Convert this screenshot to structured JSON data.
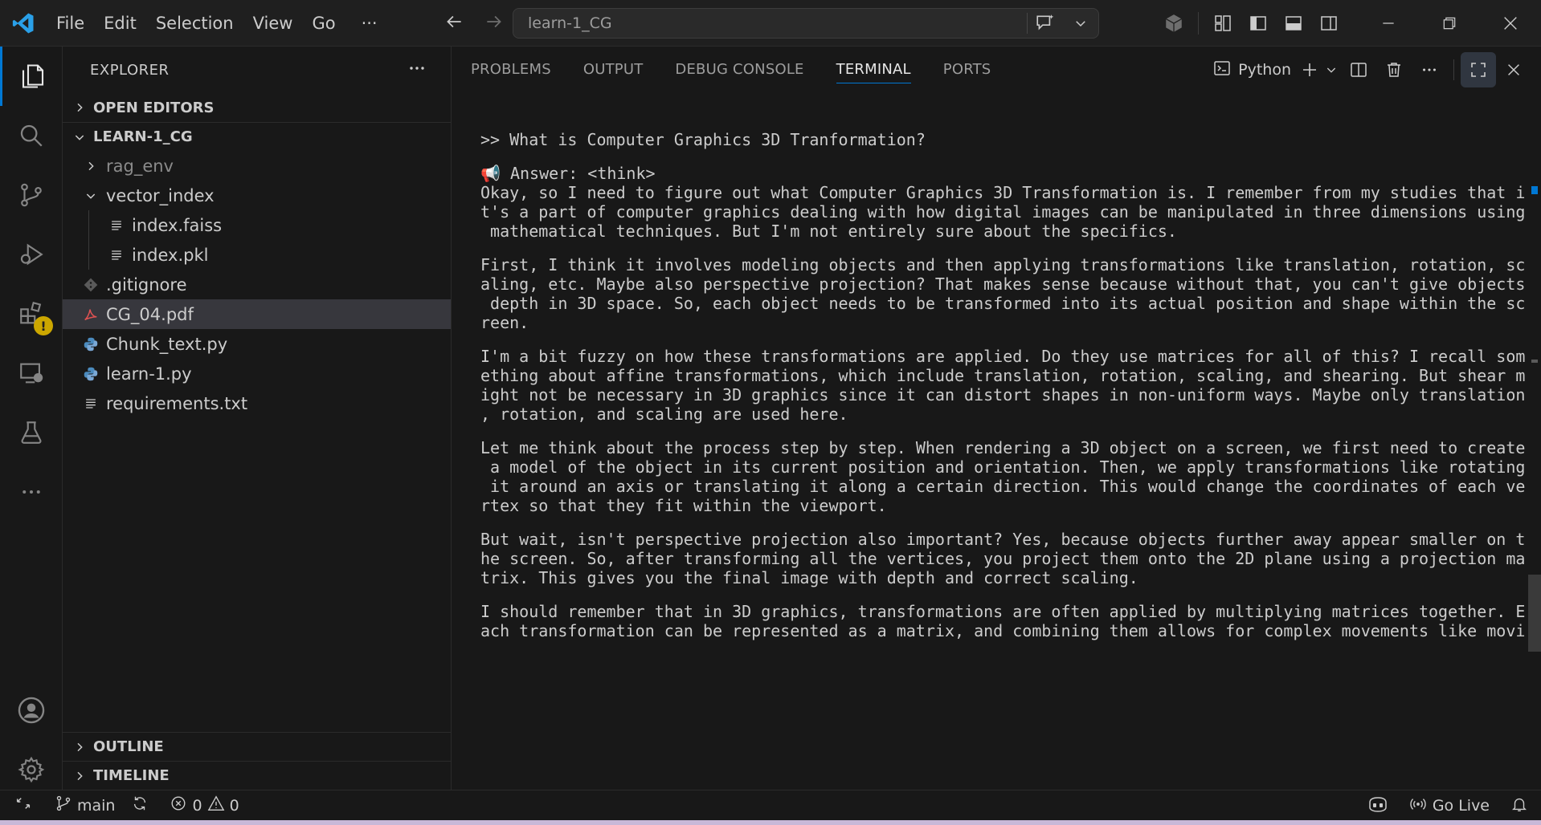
{
  "titlebar": {
    "menu": [
      "File",
      "Edit",
      "Selection",
      "View",
      "Go",
      "···"
    ],
    "search_text": "learn-1_CG"
  },
  "sidebar": {
    "title": "EXPLORER",
    "open_editors": "OPEN EDITORS",
    "project": "LEARN-1_CG",
    "tree": [
      {
        "label": "rag_env",
        "kind": "folder-collapsed",
        "dim": true
      },
      {
        "label": "vector_index",
        "kind": "folder-expanded"
      },
      {
        "label": "index.faiss",
        "kind": "file"
      },
      {
        "label": "index.pkl",
        "kind": "file"
      },
      {
        "label": ".gitignore",
        "kind": "git"
      },
      {
        "label": "CG_04.pdf",
        "kind": "pdf",
        "selected": true
      },
      {
        "label": "Chunk_text.py",
        "kind": "python"
      },
      {
        "label": "learn-1.py",
        "kind": "python"
      },
      {
        "label": "requirements.txt",
        "kind": "file"
      }
    ],
    "outline": "OUTLINE",
    "timeline": "TIMELINE"
  },
  "panel": {
    "tabs": [
      "PROBLEMS",
      "OUTPUT",
      "DEBUG CONSOLE",
      "TERMINAL",
      "PORTS"
    ],
    "active_tab": 3,
    "profile": "Python",
    "terminal_lines": [
      "",
      ">> What is Computer Graphics 3D Tranformation?",
      "",
      "📢 Answer: <think>",
      "Okay, so I need to figure out what Computer Graphics 3D Transformation is. I remember from my studies that i",
      "t's a part of computer graphics dealing with how digital images can be manipulated in three dimensions using",
      " mathematical techniques. But I'm not entirely sure about the specifics.",
      "",
      "First, I think it involves modeling objects and then applying transformations like translation, rotation, sc",
      "aling, etc. Maybe also perspective projection? That makes sense because without that, you can't give objects",
      " depth in 3D space. So, each object needs to be transformed into its actual position and shape within the sc",
      "reen.",
      "",
      "I'm a bit fuzzy on how these transformations are applied. Do they use matrices for all of this? I recall som",
      "ething about affine transformations, which include translation, rotation, scaling, and shearing. But shear m",
      "ight not be necessary in 3D graphics since it can distort shapes in non-uniform ways. Maybe only translation",
      ", rotation, and scaling are used here.",
      "",
      "Let me think about the process step by step. When rendering a 3D object on a screen, we first need to create",
      " a model of the object in its current position and orientation. Then, we apply transformations like rotating",
      " it around an axis or translating it along a certain direction. This would change the coordinates of each ve",
      "rtex so that they fit within the viewport.",
      "",
      "But wait, isn't perspective projection also important? Yes, because objects further away appear smaller on t",
      "he screen. So, after transforming all the vertices, you project them onto the 2D plane using a projection ma",
      "trix. This gives you the final image with depth and correct scaling.",
      "",
      "I should remember that in 3D graphics, transformations are often applied by multiplying matrices together. E",
      "ach transformation can be represented as a matrix, and combining them allows for complex movements like movi"
    ]
  },
  "statusbar": {
    "branch": "main",
    "errors": "0",
    "warnings": "0",
    "go_live": "Go Live"
  },
  "colors": {
    "accent": "#0078d4",
    "warning_badge": "#cca700",
    "python_icon": "#4b8bbe",
    "pdf_icon": "#e05252"
  }
}
